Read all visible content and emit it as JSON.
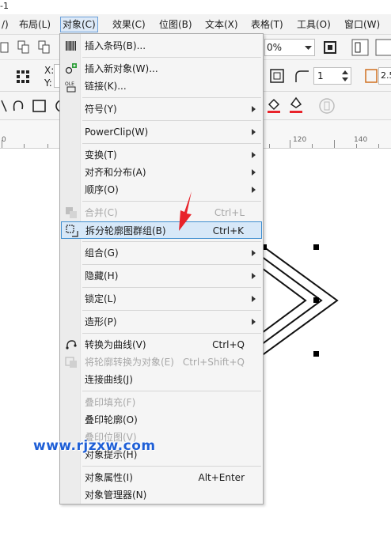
{
  "window": {
    "title_fragment": "-1"
  },
  "menubar": {
    "items": [
      {
        "label": "/)"
      },
      {
        "label": "布局(L)"
      },
      {
        "label": "对象(C)"
      },
      {
        "label": "效果(C)"
      },
      {
        "label": "位图(B)"
      },
      {
        "label": "文本(X)"
      },
      {
        "label": "表格(T)"
      },
      {
        "label": "工具(O)"
      },
      {
        "label": "窗口(W)"
      }
    ]
  },
  "toolbar": {
    "zoom_value": "0%",
    "pos_x_label": "X:",
    "pos_y_label": "Y:",
    "stepper_value": "1",
    "right_value": "2.5"
  },
  "ruler": {
    "labels": [
      "0",
      "120",
      "140"
    ]
  },
  "menu": {
    "items": [
      {
        "label": "插入条码(B)...",
        "shortcut": ""
      },
      {
        "label": "插入新对象(W)...",
        "shortcut": ""
      },
      {
        "label": "链接(K)...",
        "shortcut": ""
      },
      {
        "label": "符号(Y)",
        "shortcut": ""
      },
      {
        "label": "PowerClip(W)",
        "shortcut": ""
      },
      {
        "label": "变换(T)",
        "shortcut": ""
      },
      {
        "label": "对齐和分布(A)",
        "shortcut": ""
      },
      {
        "label": "顺序(O)",
        "shortcut": ""
      },
      {
        "label": "合并(C)",
        "shortcut": "Ctrl+L"
      },
      {
        "label": "拆分轮廓图群组(B)",
        "shortcut": "Ctrl+K"
      },
      {
        "label": "组合(G)",
        "shortcut": ""
      },
      {
        "label": "隐藏(H)",
        "shortcut": ""
      },
      {
        "label": "锁定(L)",
        "shortcut": ""
      },
      {
        "label": "造形(P)",
        "shortcut": ""
      },
      {
        "label": "转换为曲线(V)",
        "shortcut": "Ctrl+Q"
      },
      {
        "label": "将轮廓转换为对象(E)",
        "shortcut": "Ctrl+Shift+Q"
      },
      {
        "label": "连接曲线(J)",
        "shortcut": ""
      },
      {
        "label": "叠印填充(F)",
        "shortcut": ""
      },
      {
        "label": "叠印轮廓(O)",
        "shortcut": ""
      },
      {
        "label": "叠印位图(V)",
        "shortcut": ""
      },
      {
        "label": "对象提示(H)",
        "shortcut": ""
      },
      {
        "label": "对象属性(I)",
        "shortcut": "Alt+Enter"
      },
      {
        "label": "对象管理器(N)",
        "shortcut": ""
      }
    ]
  },
  "watermark": {
    "text": "www.rjzxw.com"
  },
  "colors": {
    "highlight_bg": "#d7e8f8",
    "highlight_border": "#3e8ed0",
    "arrow": "#e8232a",
    "watermark": "#1f5fd6"
  }
}
